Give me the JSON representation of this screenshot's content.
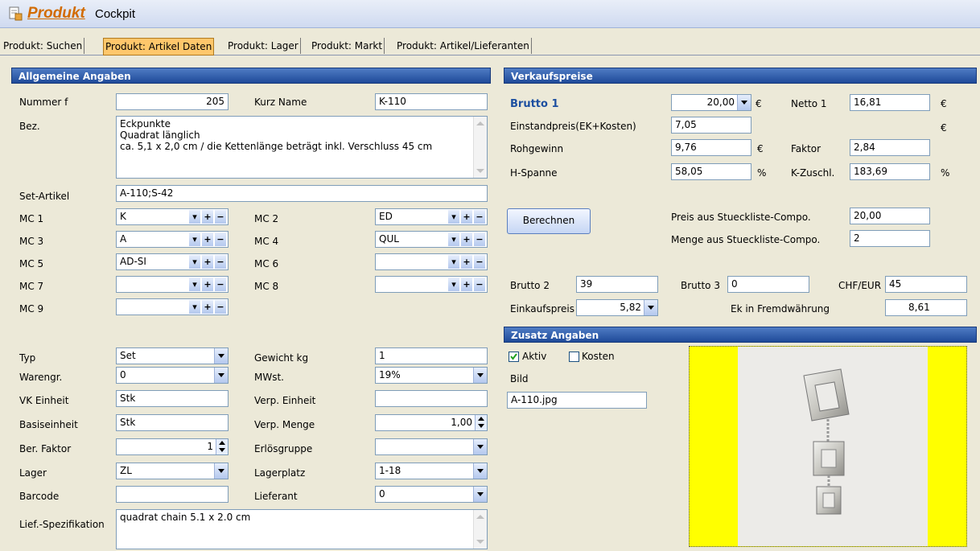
{
  "app": {
    "title": "Produkt",
    "subtitle": "Cockpit"
  },
  "tabs": [
    {
      "label": "Produkt: Suchen",
      "active": false
    },
    {
      "label": "Produkt: Artikel Daten",
      "active": true
    },
    {
      "label": "Produkt: Lager",
      "active": false
    },
    {
      "label": "Produkt: Markt",
      "active": false
    },
    {
      "label": "Produkt: Artikel/Lieferanten",
      "active": false
    }
  ],
  "allgemein": {
    "header": "Allgemeine Angaben",
    "nummer_label": "Nummer f",
    "nummer": "205",
    "kurzname_label": "Kurz Name",
    "kurzname": "K-110",
    "bez_label": "Bez.",
    "bez_lines": [
      "Eckpunkte",
      "Quadrat länglich",
      "ca. 5,1 x 2,0 cm / die Kettenlänge beträgt inkl. Verschluss 45 cm"
    ],
    "set_label": "Set-Artikel",
    "set_value": "A-110;S-42",
    "mc": {
      "mc1_label": "MC 1",
      "mc1": "K",
      "mc2_label": "MC 2",
      "mc2": "ED",
      "mc3_label": "MC 3",
      "mc3": "A",
      "mc4_label": "MC 4",
      "mc4": "QUL",
      "mc5_label": "MC 5",
      "mc5": "AD-SI",
      "mc6_label": "MC 6",
      "mc6": "",
      "mc7_label": "MC 7",
      "mc7": "",
      "mc8_label": "MC 8",
      "mc8": "",
      "mc9_label": "MC 9",
      "mc9": ""
    },
    "typ_label": "Typ",
    "typ": "Set",
    "gewicht_label": "Gewicht kg",
    "gewicht": "1",
    "warengr_label": "Warengr.",
    "warengr": "0",
    "mwst_label": "MWst.",
    "mwst": "19%",
    "vkeinheit_label": "VK Einheit",
    "vkeinheit": "Stk",
    "verpeinheit_label": "Verp. Einheit",
    "verpeinheit": "",
    "basis_label": "Basiseinheit",
    "basis": "Stk",
    "verpmenge_label": "Verp. Menge",
    "verpmenge": "1,00",
    "berfaktor_label": "Ber. Faktor",
    "berfaktor": "1",
    "erloes_label": "Erlösgruppe",
    "erloes": "",
    "lager_label": "Lager",
    "lager": "ZL",
    "lagerplatz_label": "Lagerplatz",
    "lagerplatz": "1-18",
    "barcode_label": "Barcode",
    "barcode": "",
    "lieferant_label": "Lieferant",
    "lieferant": "0",
    "liefspez_label": "Lief.-Spezifikation",
    "liefspez": "quadrat chain 5.1 x 2.0 cm"
  },
  "verkauf": {
    "header": "Verkaufspreise",
    "brutto1_label": "Brutto 1",
    "brutto1": "20,00",
    "euro": "€",
    "netto1_label": "Netto 1",
    "netto1": "16,81",
    "einstand_label": "Einstandpreis(EK+Kosten)",
    "einstand": "7,05",
    "rohgewinn_label": "Rohgewinn",
    "rohgewinn": "9,76",
    "faktor_label": "Faktor",
    "faktor": "2,84",
    "hspanne_label": "H-Spanne",
    "hspanne": "58,05",
    "percent": "%",
    "kzuschl_label": "K-Zuschl.",
    "kzuschl": "183,69",
    "berechnen": "Berechnen",
    "preis_stueck_label": "Preis aus Stueckliste-Compo.",
    "preis_stueck": "20,00",
    "menge_stueck_label": "Menge aus Stueckliste-Compo.",
    "menge_stueck": "2",
    "brutto2_label": "Brutto 2",
    "brutto2": "39",
    "brutto3_label": "Brutto 3",
    "brutto3": "0",
    "chfeur_label": "CHF/EUR",
    "chfeur": "45",
    "einkauf_label": "Einkaufspreis",
    "einkauf": "5,82",
    "ekfremd_label": "Ek in Fremdwährung",
    "ekfremd": "8,61"
  },
  "zusatz": {
    "header": "Zusatz Angaben",
    "aktiv_label": "Aktiv",
    "aktiv_checked": true,
    "kosten_label": "Kosten",
    "kosten_checked": false,
    "bild_label": "Bild",
    "bild": "A-110.jpg"
  }
}
